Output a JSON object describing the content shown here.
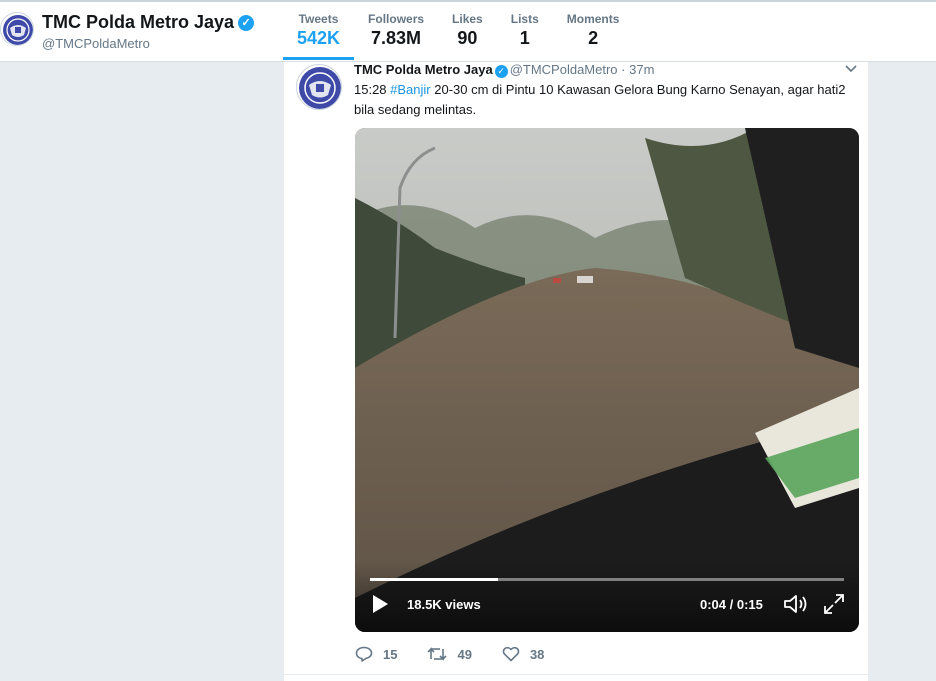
{
  "profile": {
    "name": "TMC Polda Metro Jaya",
    "handle": "@TMCPoldaMetro",
    "verified": true
  },
  "stats": [
    {
      "label": "Tweets",
      "value": "542K",
      "active": true
    },
    {
      "label": "Followers",
      "value": "7.83M"
    },
    {
      "label": "Likes",
      "value": "90"
    },
    {
      "label": "Lists",
      "value": "1"
    },
    {
      "label": "Moments",
      "value": "2"
    }
  ],
  "tweet": {
    "name": "TMC Polda Metro Jaya",
    "handle": "@TMCPoldaMetro",
    "separator": "·",
    "time": "37m",
    "text_prefix": "15:28 ",
    "hashtag": "#Banjir",
    "text_suffix": " 20-30 cm di Pintu 10 Kawasan Gelora Bung Karno Senayan, agar hati2 bila sedang melintas.",
    "video": {
      "views": "18.5K views",
      "current_time": "0:04",
      "time_separator": " / ",
      "duration": "0:15",
      "progress": 0.27
    },
    "actions": {
      "replies": "15",
      "retweets": "49",
      "likes": "38"
    }
  },
  "colors": {
    "accent": "#1da1f2",
    "background": "#e6ecf0",
    "secondary_text": "#657786"
  },
  "icons": [
    "verified-badge-icon",
    "chevron-down-icon",
    "play-icon",
    "volume-icon",
    "fullscreen-icon",
    "reply-icon",
    "retweet-icon",
    "like-icon"
  ]
}
